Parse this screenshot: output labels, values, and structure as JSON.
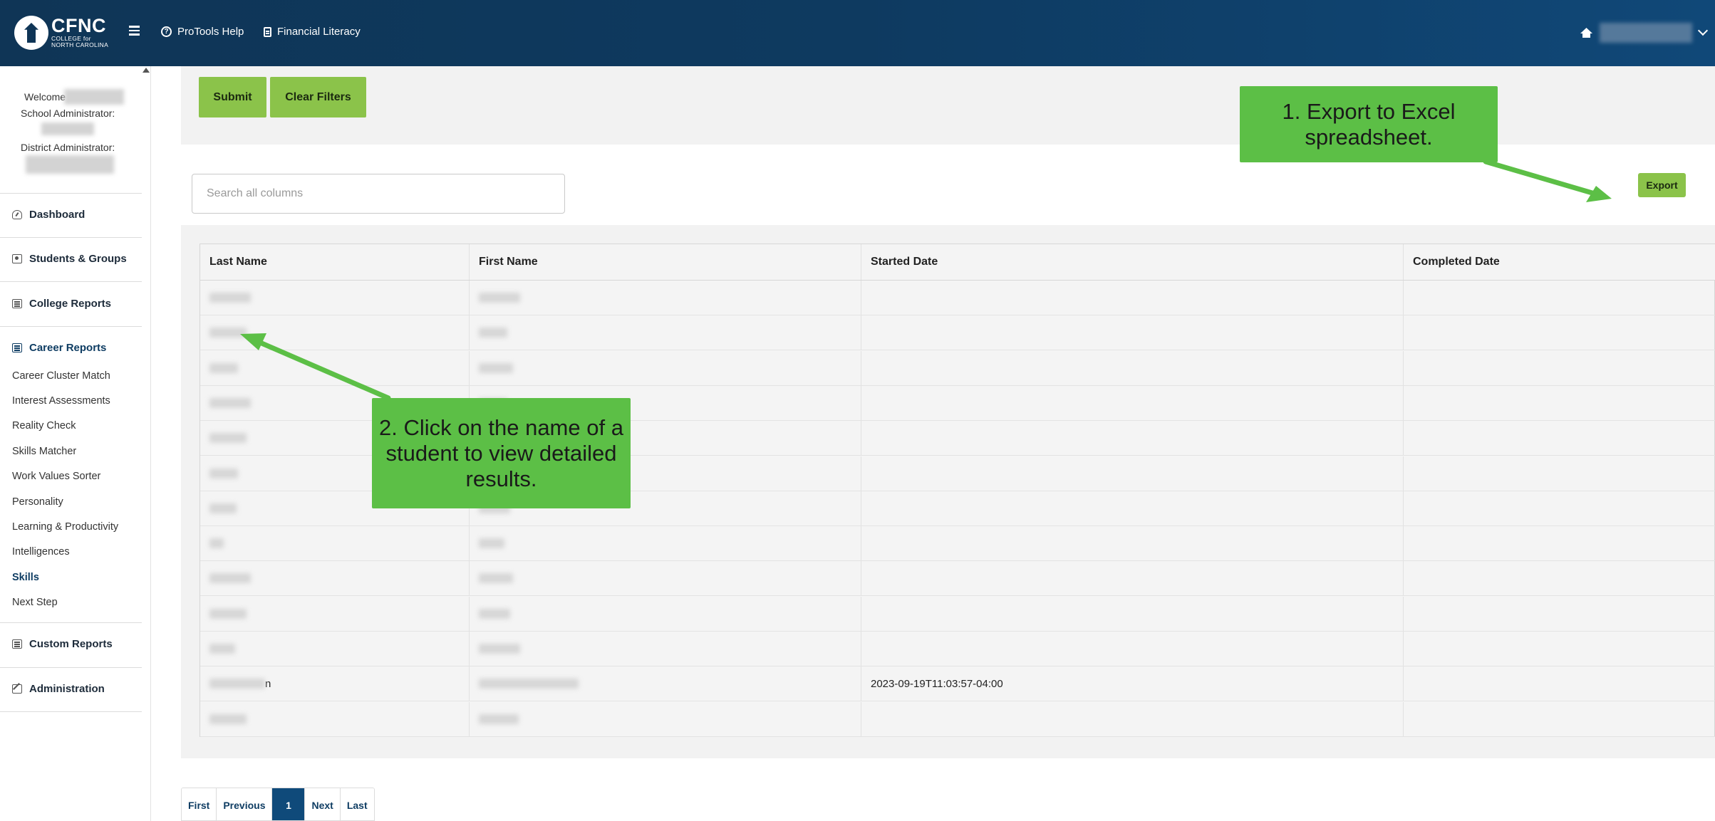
{
  "brand": {
    "name": "CFNC",
    "tagline_line1": "COLLEGE for",
    "tagline_line2": "NORTH CAROLINA",
    "logo_icon": "lighthouse-icon"
  },
  "topnav": {
    "menu_icon": "hamburger-icon",
    "items": [
      {
        "label": "ProTools Help",
        "icon": "question-circle-icon"
      },
      {
        "label": "Financial Literacy",
        "icon": "document-icon"
      }
    ],
    "school_icon": "home-icon"
  },
  "sidebar": {
    "welcome_label": "Welcome",
    "school_admin_label": "School Administrator:",
    "district_admin_label": "District Administrator:",
    "sections": [
      {
        "label": "Dashboard",
        "icon": "dashboard-icon"
      },
      {
        "label": "Students & Groups",
        "icon": "person-icon"
      },
      {
        "label": "College Reports",
        "icon": "table-icon"
      },
      {
        "label": "Career Reports",
        "icon": "table-icon"
      },
      {
        "label": "Custom Reports",
        "icon": "table-icon"
      },
      {
        "label": "Administration",
        "icon": "edit-icon"
      }
    ],
    "career_subitems": [
      "Career Cluster Match",
      "Interest Assessments",
      "Reality Check",
      "Skills Matcher",
      "Work Values Sorter",
      "Personality",
      "Learning & Productivity",
      "Intelligences",
      "Skills",
      "Next Step"
    ],
    "active_subitem": "Skills"
  },
  "filters": {
    "submit_label": "Submit",
    "clear_label": "Clear Filters"
  },
  "search": {
    "placeholder": "Search all columns",
    "value": ""
  },
  "export_label": "Export",
  "table": {
    "columns": [
      "Last Name",
      "First Name",
      "Started Date",
      "Completed Date"
    ],
    "rows": [
      {
        "last": "",
        "first": "",
        "started": "",
        "completed": ""
      },
      {
        "last": "",
        "first": "",
        "started": "",
        "completed": ""
      },
      {
        "last": "",
        "first": "",
        "started": "",
        "completed": ""
      },
      {
        "last": "",
        "first": "",
        "started": "",
        "completed": ""
      },
      {
        "last": "",
        "first": "",
        "started": "",
        "completed": ""
      },
      {
        "last": "",
        "first": "",
        "started": "",
        "completed": ""
      },
      {
        "last": "",
        "first": "",
        "started": "",
        "completed": ""
      },
      {
        "last": "",
        "first": "",
        "started": "",
        "completed": ""
      },
      {
        "last": "",
        "first": "",
        "started": "",
        "completed": ""
      },
      {
        "last": "",
        "first": "",
        "started": "",
        "completed": ""
      },
      {
        "last": "",
        "first": "",
        "started": "",
        "completed": ""
      },
      {
        "last": "n",
        "first": "",
        "started": "2023-09-19T11:03:57-04:00",
        "completed": ""
      },
      {
        "last": "",
        "first": "",
        "started": "",
        "completed": ""
      }
    ]
  },
  "pagination": {
    "first": "First",
    "previous": "Previous",
    "current": "1",
    "next": "Next",
    "last": "Last"
  },
  "callouts": {
    "export_note": "1. Export to Excel spreadsheet.",
    "student_note": "2. Click on the name of a student to view detailed results."
  },
  "colors": {
    "header": "#0f3556",
    "accent_green": "#8bc34a",
    "callout_green": "#5cbf46",
    "active_page": "#0f4a7a"
  }
}
